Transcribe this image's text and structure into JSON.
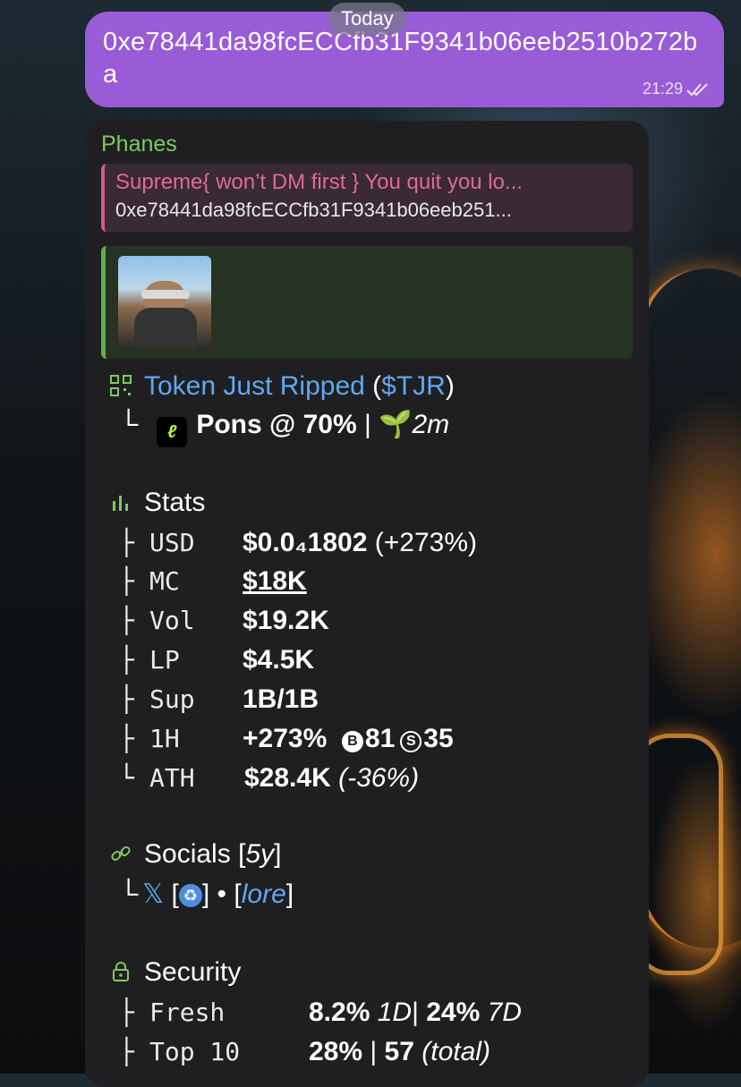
{
  "date_pill": "Today",
  "outgoing": {
    "text": "0xe78441da98fcECCfb31F9341b06eeb2510b272ba",
    "time": "21:29"
  },
  "incoming": {
    "sender": "Phanes",
    "reply": {
      "title": "Supreme{ won’t DM first } You quit you lo...",
      "text": "0xe78441da98fcECCfb31F9341b06eeb251..."
    },
    "token": {
      "name": "Token Just Ripped",
      "ticker_open": "(",
      "ticker": "$TJR",
      "ticker_close": ")",
      "tree": "└",
      "platform": "Pons @ 70%",
      "sep": "|",
      "age": "2m"
    },
    "stats": {
      "title": "Stats",
      "rows": [
        {
          "tree": "├",
          "key": "USD",
          "value": "$0.0₄1802",
          "extra": " (+273%)"
        },
        {
          "tree": "├",
          "key": "MC",
          "value": "$18K",
          "extra": ""
        },
        {
          "tree": "├",
          "key": "Vol",
          "value": "$19.2K",
          "extra": ""
        },
        {
          "tree": "├",
          "key": "LP",
          "value": "$4.5K",
          "extra": ""
        },
        {
          "tree": "├",
          "key": "Sup",
          "value": "1B/1B",
          "extra": ""
        },
        {
          "tree": "├",
          "key": "1H",
          "value": "+273%",
          "extra": ""
        },
        {
          "tree": "└",
          "key": "ATH",
          "value": "$28.4K",
          "extra": " (-36%)"
        }
      ],
      "buys_icon": "B",
      "buys": "81",
      "sells_icon": "S",
      "sells": "35"
    },
    "socials": {
      "title": "Socials",
      "age_open": "[",
      "age": "5y",
      "age_close": "]",
      "tree": "└",
      "x_label": "𝕏",
      "badge_open": "[",
      "badge_close": "]",
      "dot": "•",
      "lore_open": "[",
      "lore": "lore",
      "lore_close": "]"
    },
    "security": {
      "title": "Security",
      "rows": [
        {
          "tree": "├",
          "key": "Fresh",
          "v1": "8.2%",
          "v1u": "1D",
          "sep": "|",
          "v2": "24%",
          "v2u": "7D"
        },
        {
          "tree": "├",
          "key": "Top 10",
          "v1": "28%",
          "v1u": "",
          "sep": "|",
          "v2": "57",
          "v2u": "(total)"
        }
      ]
    }
  },
  "colors": {
    "outgoing_bubble": "#9a5bd6",
    "incoming_bubble": "#1f1f21",
    "sender": "#7bcb5f",
    "reply_accent": "#d25a86",
    "link": "#5fa8f0"
  },
  "icons": [
    "double-check-icon",
    "qr-icon",
    "pons-app-icon",
    "seedling-icon",
    "bar-chart-icon",
    "link-icon",
    "x-logo-icon",
    "recycle-badge-icon",
    "lock-icon"
  ]
}
